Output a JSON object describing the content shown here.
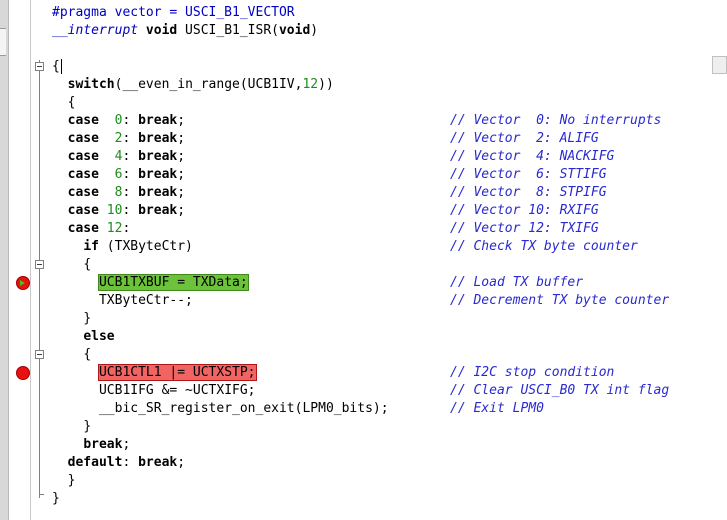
{
  "editor": {
    "lines": [
      {
        "indent": 0,
        "segments": [
          {
            "t": "#pragma vector = USCI_B1_VECTOR",
            "c": "pre"
          }
        ]
      },
      {
        "indent": 0,
        "segments": [
          {
            "t": "__interrupt",
            "c": "intr"
          },
          {
            "t": " "
          },
          {
            "t": "void",
            "c": "kw"
          },
          {
            "t": " USCI_B1_ISR("
          },
          {
            "t": "void",
            "c": "kw"
          },
          {
            "t": ")"
          }
        ]
      },
      {
        "indent": 0,
        "segments": []
      },
      {
        "indent": 0,
        "segments": [
          {
            "t": "{"
          }
        ],
        "cursor": true
      },
      {
        "indent": 2,
        "segments": [
          {
            "t": "switch",
            "c": "kw"
          },
          {
            "t": "(__even_in_range(UCB1IV,"
          },
          {
            "t": "12",
            "c": "num"
          },
          {
            "t": "))"
          }
        ]
      },
      {
        "indent": 2,
        "segments": [
          {
            "t": "{"
          }
        ]
      },
      {
        "indent": 2,
        "segments": [
          {
            "t": "case",
            "c": "kw"
          },
          {
            "t": "  "
          },
          {
            "t": "0",
            "c": "num"
          },
          {
            "t": ": "
          },
          {
            "t": "break",
            "c": "kw"
          },
          {
            "t": ";"
          }
        ],
        "comment": "// Vector  0: No interrupts"
      },
      {
        "indent": 2,
        "segments": [
          {
            "t": "case",
            "c": "kw"
          },
          {
            "t": "  "
          },
          {
            "t": "2",
            "c": "num"
          },
          {
            "t": ": "
          },
          {
            "t": "break",
            "c": "kw"
          },
          {
            "t": ";"
          }
        ],
        "comment": "// Vector  2: ALIFG"
      },
      {
        "indent": 2,
        "segments": [
          {
            "t": "case",
            "c": "kw"
          },
          {
            "t": "  "
          },
          {
            "t": "4",
            "c": "num"
          },
          {
            "t": ": "
          },
          {
            "t": "break",
            "c": "kw"
          },
          {
            "t": ";"
          }
        ],
        "comment": "// Vector  4: NACKIFG"
      },
      {
        "indent": 2,
        "segments": [
          {
            "t": "case",
            "c": "kw"
          },
          {
            "t": "  "
          },
          {
            "t": "6",
            "c": "num"
          },
          {
            "t": ": "
          },
          {
            "t": "break",
            "c": "kw"
          },
          {
            "t": ";"
          }
        ],
        "comment": "// Vector  6: STTIFG"
      },
      {
        "indent": 2,
        "segments": [
          {
            "t": "case",
            "c": "kw"
          },
          {
            "t": "  "
          },
          {
            "t": "8",
            "c": "num"
          },
          {
            "t": ": "
          },
          {
            "t": "break",
            "c": "kw"
          },
          {
            "t": ";"
          }
        ],
        "comment": "// Vector  8: STPIFG"
      },
      {
        "indent": 2,
        "segments": [
          {
            "t": "case",
            "c": "kw"
          },
          {
            "t": " "
          },
          {
            "t": "10",
            "c": "num"
          },
          {
            "t": ": "
          },
          {
            "t": "break",
            "c": "kw"
          },
          {
            "t": ";"
          }
        ],
        "comment": "// Vector 10: RXIFG"
      },
      {
        "indent": 2,
        "segments": [
          {
            "t": "case",
            "c": "kw"
          },
          {
            "t": " "
          },
          {
            "t": "12",
            "c": "num"
          },
          {
            "t": ":"
          }
        ],
        "comment": "// Vector 12: TXIFG"
      },
      {
        "indent": 4,
        "segments": [
          {
            "t": "if",
            "c": "kw"
          },
          {
            "t": " (TXByteCtr)"
          }
        ],
        "comment": "// Check TX byte counter"
      },
      {
        "indent": 4,
        "segments": [
          {
            "t": "{"
          }
        ]
      },
      {
        "indent": 6,
        "segments": [
          {
            "t": "UCB1TXBUF = TXData;",
            "h": "green"
          }
        ],
        "comment": "// Load TX buffer"
      },
      {
        "indent": 6,
        "segments": [
          {
            "t": "TXByteCtr--;"
          }
        ],
        "comment": "// Decrement TX byte counter"
      },
      {
        "indent": 4,
        "segments": [
          {
            "t": "}"
          }
        ]
      },
      {
        "indent": 4,
        "segments": [
          {
            "t": "else",
            "c": "kw"
          }
        ]
      },
      {
        "indent": 4,
        "segments": [
          {
            "t": "{"
          }
        ]
      },
      {
        "indent": 6,
        "segments": [
          {
            "t": "UCB1CTL1 |= UCTXSTP;",
            "h": "red"
          }
        ],
        "comment": "// I2C stop condition"
      },
      {
        "indent": 6,
        "segments": [
          {
            "t": "UCB1IFG &= ~UCTXIFG;"
          }
        ],
        "comment": "// Clear USCI_B0 TX int flag"
      },
      {
        "indent": 6,
        "segments": [
          {
            "t": "__bic_SR_register_on_exit(LPM0_bits);"
          }
        ],
        "comment": "// Exit LPM0"
      },
      {
        "indent": 4,
        "segments": [
          {
            "t": "}"
          }
        ]
      },
      {
        "indent": 4,
        "segments": [
          {
            "t": "break",
            "c": "kw"
          },
          {
            "t": ";"
          }
        ]
      },
      {
        "indent": 2,
        "segments": [
          {
            "t": "default",
            "c": "kw"
          },
          {
            "t": ": "
          },
          {
            "t": "break",
            "c": "kw"
          },
          {
            "t": ";"
          }
        ]
      },
      {
        "indent": 2,
        "segments": [
          {
            "t": "}"
          }
        ]
      },
      {
        "indent": 0,
        "segments": [
          {
            "t": "}"
          }
        ]
      }
    ],
    "breakpoints": [
      {
        "line": 15,
        "type": "current-statement-breakpoint",
        "color": "#e81010",
        "arrow_color": "#3ec81e"
      },
      {
        "line": 20,
        "type": "breakpoint",
        "color": "#e81010"
      }
    ],
    "folds": [
      3,
      14,
      19
    ],
    "colors": {
      "keyword": "#000000",
      "preprocessor": "#0000c0",
      "number": "#1c8c1c",
      "comment": "#2a2ad0",
      "current_line_highlight": "#6cc23a",
      "breakpoint_highlight": "#f06464"
    }
  }
}
